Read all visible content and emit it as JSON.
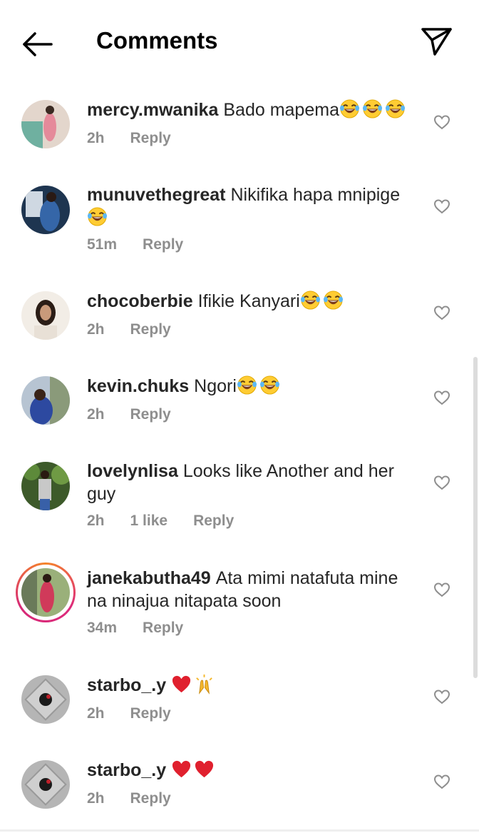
{
  "header": {
    "title": "Comments"
  },
  "comments": [
    {
      "username": "mercy.mwanika",
      "text": "Bado mapema",
      "emojis": [
        "laugh",
        "laugh",
        "laugh"
      ],
      "time": "2h",
      "likes": "",
      "reply": "Reply",
      "avatar_color": "#c9b2a0",
      "story": false
    },
    {
      "username": "munuvethegreat",
      "text": "Nikifika hapa mnipige",
      "emojis": [
        "laugh"
      ],
      "time": "51m",
      "likes": "",
      "reply": "Reply",
      "avatar_color": "#2c4a72",
      "story": false
    },
    {
      "username": "chocoberbie",
      "text": "Ifikie Kanyari",
      "emojis": [
        "laugh",
        "laugh"
      ],
      "time": "2h",
      "likes": "",
      "reply": "Reply",
      "avatar_color": "#d8d0c3",
      "story": false
    },
    {
      "username": "kevin.chuks",
      "text": "Ngori",
      "emojis": [
        "laugh",
        "laugh"
      ],
      "time": "2h",
      "likes": "",
      "reply": "Reply",
      "avatar_color": "#9aa8b7",
      "story": false
    },
    {
      "username": "lovelynlisa",
      "text": "Looks like Another and her guy",
      "emojis": [],
      "time": "2h",
      "likes": "1 like",
      "reply": "Reply",
      "avatar_color": "#4a6b3a",
      "story": false
    },
    {
      "username": "janekabutha49",
      "text": "Ata mimi natafuta mine na ninajua nitapata soon",
      "emojis": [],
      "time": "34m",
      "likes": "",
      "reply": "Reply",
      "avatar_color": "#7c9a6b",
      "story": true
    },
    {
      "username": "starbo_.y",
      "text": "",
      "emojis": [
        "heart",
        "pray"
      ],
      "time": "2h",
      "likes": "",
      "reply": "Reply",
      "avatar_color": "#a8a8a8",
      "story": false
    },
    {
      "username": "starbo_.y",
      "text": "",
      "emojis": [
        "heart",
        "heart"
      ],
      "time": "2h",
      "likes": "",
      "reply": "Reply",
      "avatar_color": "#a8a8a8",
      "story": false
    }
  ]
}
